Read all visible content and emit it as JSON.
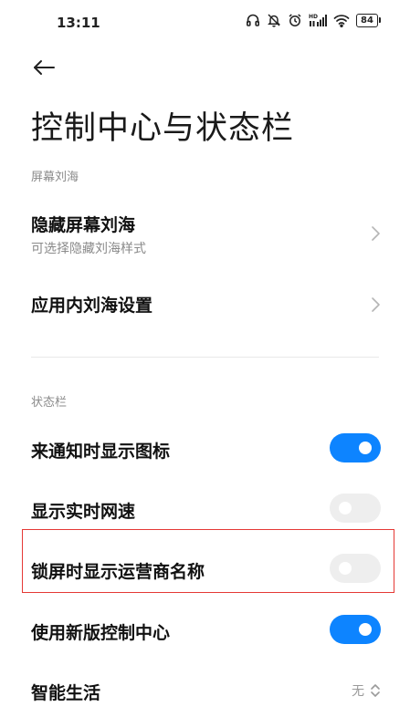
{
  "status_bar": {
    "time": "13:11",
    "battery": "84",
    "network_label": "HD"
  },
  "page": {
    "title": "控制中心与状态栏"
  },
  "sections": {
    "notch": {
      "header": "屏幕刘海",
      "hide_notch": {
        "title": "隐藏屏幕刘海",
        "subtitle": "可选择隐藏刘海样式"
      },
      "in_app_notch": {
        "title": "应用内刘海设置"
      }
    },
    "status_bar": {
      "header": "状态栏",
      "show_notification_icons": {
        "title": "来通知时显示图标",
        "enabled": true
      },
      "show_network_speed": {
        "title": "显示实时网速",
        "enabled": false
      },
      "show_carrier_lockscreen": {
        "title": "锁屏时显示运营商名称",
        "enabled": false
      },
      "new_control_center": {
        "title": "使用新版控制中心",
        "enabled": true
      },
      "smart_life": {
        "title": "智能生活",
        "value": "无"
      }
    }
  },
  "colors": {
    "toggle_on": "#0d84ff",
    "toggle_off": "#eeeeee",
    "highlight": "#e53935"
  }
}
